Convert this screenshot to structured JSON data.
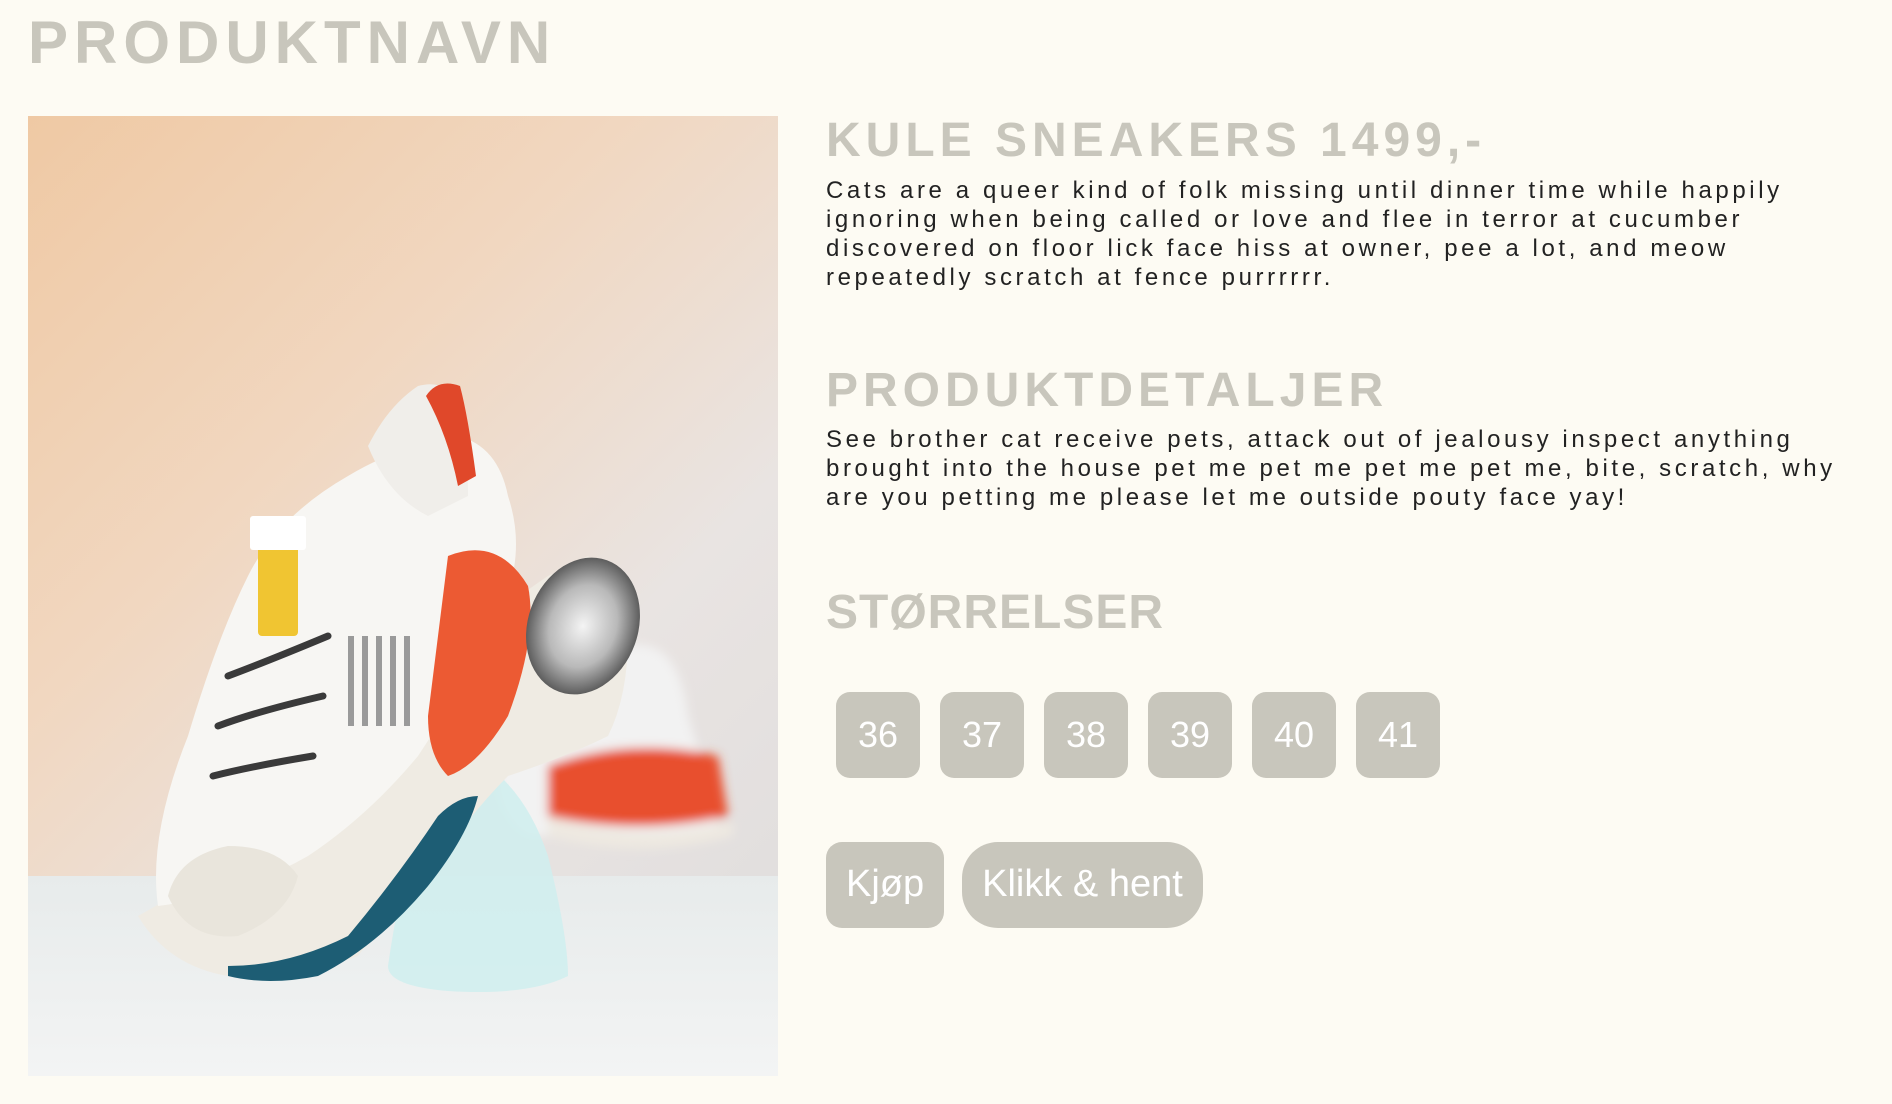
{
  "page": {
    "title": "PRODUKTNAVN"
  },
  "product": {
    "name_price": "KULE SNEAKERS 1499,-",
    "description": "Cats are a queer kind of folk missing until dinner time while happily ignoring when being called or love and flee in terror at cucumber discovered on floor lick face hiss at owner, pee a lot, and meow repeatedly scratch at fence purrrrrr.",
    "image_alt": "sneaker-photo"
  },
  "details": {
    "heading": "PRODUKTDETALJER",
    "text": "See brother cat receive pets, attack out of jealousy inspect anything brought into the house pet me pet me pet me pet me, bite, scratch, why are you petting me please let me outside pouty face yay!"
  },
  "sizes": {
    "heading": "STØRRELSER",
    "options": [
      "36",
      "37",
      "38",
      "39",
      "40",
      "41"
    ]
  },
  "actions": {
    "buy_label": "Kjøp",
    "click_collect_label": "Klikk & hent"
  },
  "colors": {
    "background": "#fdfbf3",
    "accent": "#c8c6bc",
    "text": "#222222",
    "button_text": "#ffffff"
  }
}
